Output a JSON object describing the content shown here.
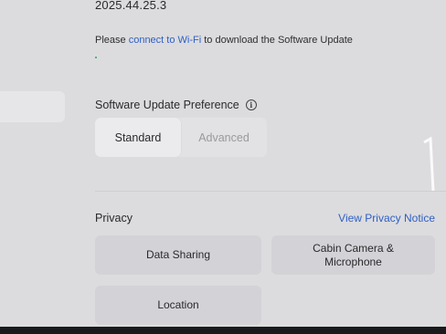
{
  "software": {
    "version": "2025.44.25.3",
    "wifi_message_prefix": "Please ",
    "wifi_link": "connect to Wi-Fi",
    "wifi_message_suffix": " to download the Software Update"
  },
  "update_preference": {
    "title": "Software Update Preference",
    "info_icon": "info-icon",
    "options": [
      "Standard",
      "Advanced"
    ],
    "selected": "Standard"
  },
  "privacy": {
    "title": "Privacy",
    "link": "View Privacy Notice",
    "tiles": {
      "data_sharing": "Data Sharing",
      "cabin_camera_line1": "Cabin Camera &",
      "cabin_camera_line2": "Microphone",
      "location": "Location"
    }
  },
  "colors": {
    "accent_link": "#2f5fc4",
    "background": "#dcdcdf",
    "tile": "#d3d3d7"
  }
}
